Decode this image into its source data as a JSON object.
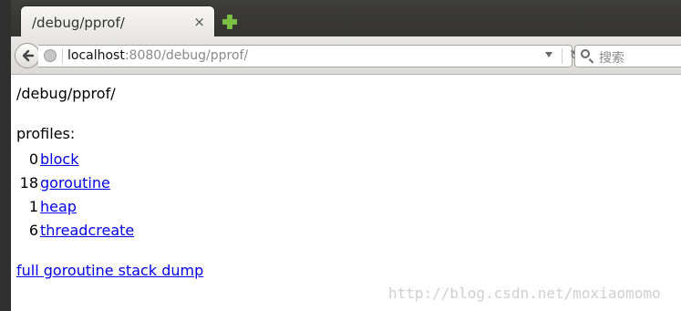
{
  "browser": {
    "tab_title": "/debug/pprof/",
    "tab_close": "×",
    "url_host": "localhost",
    "url_rest": ":8080/debug/pprof/",
    "search_placeholder": "搜索"
  },
  "page": {
    "heading": "/debug/pprof/",
    "profiles_label": "profiles:",
    "profiles": [
      {
        "count": "0",
        "name": "block"
      },
      {
        "count": "18",
        "name": "goroutine"
      },
      {
        "count": "1",
        "name": "heap"
      },
      {
        "count": "6",
        "name": "threadcreate"
      }
    ],
    "full_dump_link": "full goroutine stack dump"
  },
  "watermark": "http://blog.csdn.net/moxiaomomo"
}
